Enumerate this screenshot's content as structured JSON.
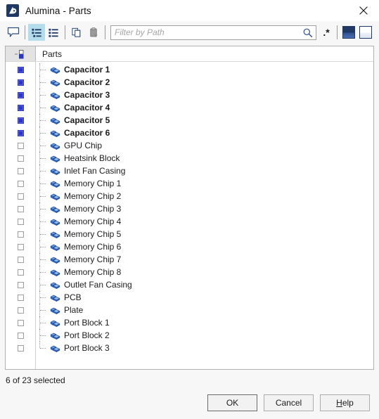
{
  "window": {
    "title": "Alumina - Parts",
    "app_icon": "alumina-app-icon",
    "close_icon": "close-icon"
  },
  "toolbar": {
    "comment_icon": "comment-bubble-icon",
    "list_detail_icon": "list-detailed-icon",
    "list_flat_icon": "list-flat-icon",
    "copy_icon": "copy-icon",
    "paste_icon": "paste-icon",
    "search_icon": "search-icon",
    "regex_label": ".*",
    "regex_icon": "regex-icon",
    "solid_panel_icon": "solid-square-icon",
    "outline_panel_icon": "outline-square-icon"
  },
  "filter": {
    "placeholder": "Filter by Path",
    "value": ""
  },
  "tree": {
    "header": {
      "check_icon": "tree-select-icon",
      "column_label": "Parts"
    },
    "items": [
      {
        "label": "Capacitor 1",
        "selected": true
      },
      {
        "label": "Capacitor 2",
        "selected": true
      },
      {
        "label": "Capacitor 3",
        "selected": true
      },
      {
        "label": "Capacitor 4",
        "selected": true
      },
      {
        "label": "Capacitor 5",
        "selected": true
      },
      {
        "label": "Capacitor 6",
        "selected": true
      },
      {
        "label": "GPU Chip",
        "selected": false
      },
      {
        "label": "Heatsink Block",
        "selected": false
      },
      {
        "label": "Inlet Fan Casing",
        "selected": false
      },
      {
        "label": "Memory Chip 1",
        "selected": false
      },
      {
        "label": "Memory Chip 2",
        "selected": false
      },
      {
        "label": "Memory Chip 3",
        "selected": false
      },
      {
        "label": "Memory Chip 4",
        "selected": false
      },
      {
        "label": "Memory Chip 5",
        "selected": false
      },
      {
        "label": "Memory Chip 6",
        "selected": false
      },
      {
        "label": "Memory Chip 7",
        "selected": false
      },
      {
        "label": "Memory Chip 8",
        "selected": false
      },
      {
        "label": "Outlet Fan Casing",
        "selected": false
      },
      {
        "label": "PCB",
        "selected": false
      },
      {
        "label": "Plate",
        "selected": false
      },
      {
        "label": "Port Block 1",
        "selected": false
      },
      {
        "label": "Port Block 2",
        "selected": false
      },
      {
        "label": "Port Block 3",
        "selected": false
      }
    ]
  },
  "status": {
    "text": "6 of 23 selected"
  },
  "footer": {
    "ok": "OK",
    "cancel": "Cancel",
    "help_prefix": "",
    "help_accel": "H",
    "help_suffix": "elp"
  },
  "colors": {
    "accent_blue": "#2c36c4",
    "icon_blue": "#3b6fd4",
    "toolbar_active": "#b5dceb",
    "title_icon": "#1f3864"
  }
}
